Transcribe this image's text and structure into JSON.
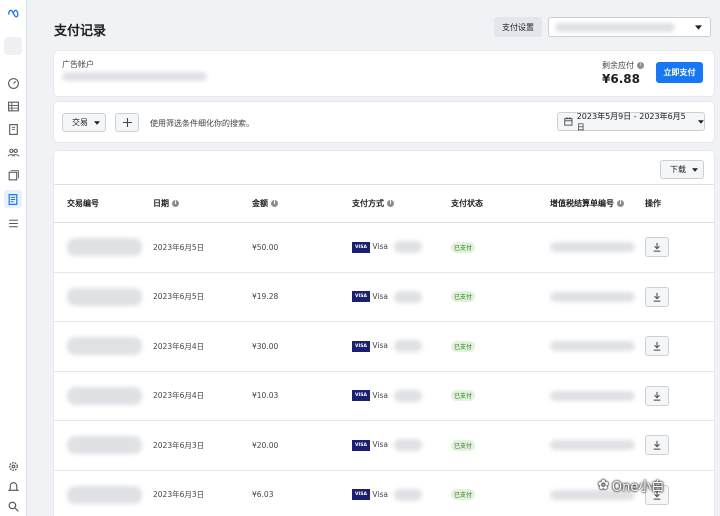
{
  "page": {
    "title": "支付记录",
    "settings_label": "支付设置"
  },
  "account": {
    "label": "广告帐户",
    "balance_label": "剩余应付",
    "balance": "¥6.88",
    "pay_button": "立即支付"
  },
  "filters": {
    "trade_label": "交易",
    "hint": "使用筛选条件细化你的搜索。",
    "date_range": "2023年5月9日 - 2023年6月5日"
  },
  "table": {
    "download_label": "下载",
    "headers": [
      "交易编号",
      "日期",
      "金额",
      "支付方式",
      "支付状态",
      "增值税结算单编号",
      "操作"
    ],
    "rows": [
      {
        "date": "2023年6月5日",
        "amount": "¥50.00",
        "method": "Visa",
        "status": "已支付"
      },
      {
        "date": "2023年6月5日",
        "amount": "¥19.28",
        "method": "Visa",
        "status": "已支付"
      },
      {
        "date": "2023年6月4日",
        "amount": "¥30.00",
        "method": "Visa",
        "status": "已支付"
      },
      {
        "date": "2023年6月4日",
        "amount": "¥10.03",
        "method": "Visa",
        "status": "已支付"
      },
      {
        "date": "2023年6月3日",
        "amount": "¥20.00",
        "method": "Visa",
        "status": "已支付"
      },
      {
        "date": "2023年6月3日",
        "amount": "¥6.03",
        "method": "Visa",
        "status": "已支付"
      }
    ]
  },
  "watermark": "One小白",
  "icons": [
    "meta-logo",
    "dashboard-icon",
    "table-icon",
    "pages-icon",
    "audience-icon",
    "catalog-icon",
    "billing-icon",
    "menu-icon",
    "settings-icon",
    "bell-icon",
    "search-icon",
    "calendar-icon",
    "download-icon",
    "plus-icon"
  ]
}
